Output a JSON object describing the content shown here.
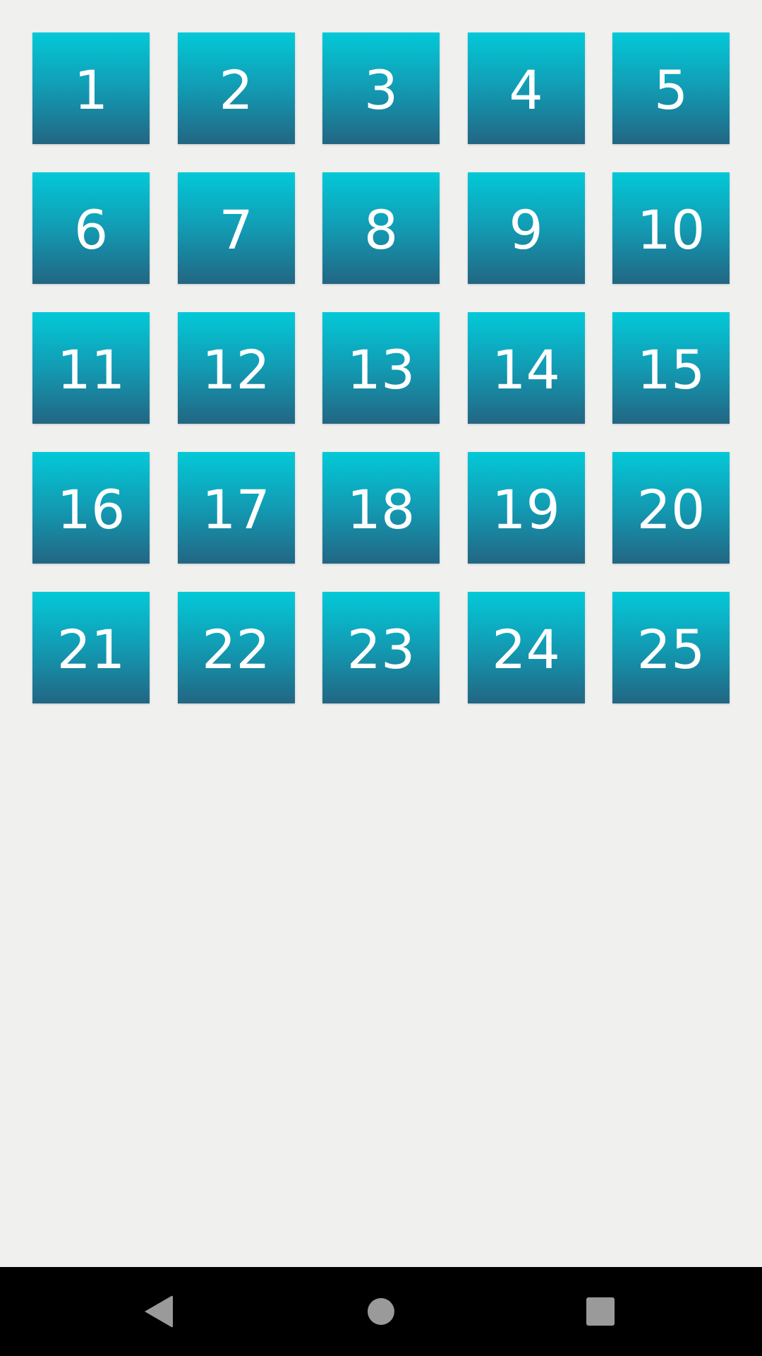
{
  "level_grid": {
    "tiles": [
      {
        "label": "1"
      },
      {
        "label": "2"
      },
      {
        "label": "3"
      },
      {
        "label": "4"
      },
      {
        "label": "5"
      },
      {
        "label": "6"
      },
      {
        "label": "7"
      },
      {
        "label": "8"
      },
      {
        "label": "9"
      },
      {
        "label": "10"
      },
      {
        "label": "11"
      },
      {
        "label": "12"
      },
      {
        "label": "13"
      },
      {
        "label": "14"
      },
      {
        "label": "15"
      },
      {
        "label": "16"
      },
      {
        "label": "17"
      },
      {
        "label": "18"
      },
      {
        "label": "19"
      },
      {
        "label": "20"
      },
      {
        "label": "21"
      },
      {
        "label": "22"
      },
      {
        "label": "23"
      },
      {
        "label": "24"
      },
      {
        "label": "25"
      }
    ]
  },
  "nav_bar": {
    "back_icon": "back-triangle-icon",
    "home_icon": "home-circle-icon",
    "recents_icon": "recents-square-icon"
  },
  "colors": {
    "background": "#f0f1ef",
    "tile_top": "#03c9d8",
    "tile_bottom": "#226683",
    "tile_text": "#ffffff",
    "navbar": "#000000",
    "nav_icon": "#9a9a9a"
  }
}
